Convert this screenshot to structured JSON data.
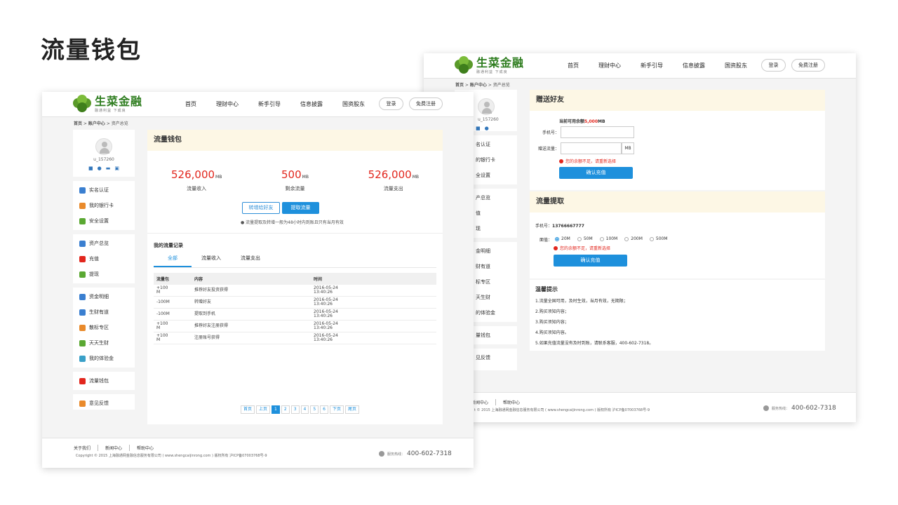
{
  "page_title": "流量钱包",
  "site": {
    "logo_name": "生菜金融",
    "logo_slogan": "融通利益 下成良",
    "nav": [
      "首页",
      "理财中心",
      "新手引导",
      "信息披露",
      "国资股东"
    ],
    "login": "登录",
    "register": "免费注册",
    "crumb_home": "首页",
    "crumb_account": "账户中心",
    "crumb_current": "资产总览"
  },
  "user": {
    "name": "u_157260"
  },
  "sidebar": {
    "groups": [
      [
        {
          "label": "实名认证",
          "color": "#3a7fd0"
        },
        {
          "label": "我的银行卡",
          "color": "#e98a2b"
        },
        {
          "label": "安全设置",
          "color": "#5aa832"
        }
      ],
      [
        {
          "label": "资产总览",
          "color": "#3a7fd0"
        },
        {
          "label": "充值",
          "color": "#e2261d"
        },
        {
          "label": "提现",
          "color": "#5aa832"
        }
      ],
      [
        {
          "label": "资金明细",
          "color": "#3a7fd0"
        },
        {
          "label": "生财有道",
          "color": "#3a7fd0"
        },
        {
          "label": "散标专区",
          "color": "#e98a2b"
        },
        {
          "label": "天天生财",
          "color": "#5aa832"
        },
        {
          "label": "我的体验金",
          "color": "#3aa0c8"
        }
      ],
      [
        {
          "label": "流量钱包",
          "color": "#e2261d"
        }
      ],
      [
        {
          "label": "意见反馈",
          "color": "#e98a2b"
        }
      ]
    ]
  },
  "back_sidebar": {
    "groups": [
      [
        "名认证",
        "的银行卡",
        "全设置"
      ],
      [
        "产总览",
        "值",
        "现"
      ],
      [
        "金明细",
        "财有道",
        "标专区",
        "天生财",
        "的体验金"
      ],
      [
        "量钱包"
      ],
      [
        "见反馈"
      ]
    ]
  },
  "wallet": {
    "title": "流量钱包",
    "stats": [
      {
        "value": "526,000",
        "unit": "MB",
        "label": "流量收入"
      },
      {
        "value": "500",
        "unit": "MB",
        "label": "剩余流量"
      },
      {
        "value": "526,000",
        "unit": "MB",
        "label": "流量支出"
      }
    ],
    "gift_btn": "转增给好友",
    "withdraw_btn": "提取流量",
    "note": "流量提取及转增一般为48小时内到账且只有当月有效",
    "records_title": "我的流量记录",
    "tabs": [
      "全部",
      "流量收入",
      "流量支出"
    ],
    "columns": [
      "流量包",
      "内容",
      "时间"
    ],
    "rows": [
      {
        "pkg": "+100\nM",
        "content": "推荐好友投资获得",
        "time": "2016-05-24\n13:40:26"
      },
      {
        "pkg": "-100M",
        "content": "转赠好友",
        "time": "2016-05-24\n13:40:26"
      },
      {
        "pkg": "-100M",
        "content": "提取到手机",
        "time": "2016-05-24\n13:40:26"
      },
      {
        "pkg": "+100\nM",
        "content": "推荐好友注册获得",
        "time": "2016-05-24\n13:40:26"
      },
      {
        "pkg": "+100\nM",
        "content": "注册账号获得",
        "time": "2016-05-24\n13:40:26"
      }
    ],
    "pager": {
      "first": "首页",
      "prev": "上页",
      "pages": [
        "1",
        "2",
        "3",
        "4",
        "5",
        "6"
      ],
      "next": "下页",
      "last": "尾页"
    }
  },
  "gift": {
    "title": "赠送好友",
    "balance_label": "当前可用余额",
    "balance_value": "5,000",
    "balance_unit": "MB",
    "phone_label": "手机号：",
    "amount_label": "赠送流量：",
    "amount_unit": "MB",
    "error": "您的余额不足，请重新选择",
    "confirm": "确认充值"
  },
  "withdraw": {
    "title": "流量提取",
    "phone_label": "手机号：",
    "phone_value": "13766667777",
    "face_label": "面值：",
    "options": [
      "20M",
      "50M",
      "100M",
      "200M",
      "500M"
    ],
    "error": "您的余额不足，请重新选择",
    "confirm": "确认充值"
  },
  "tips": {
    "title": "温馨提示",
    "lines": [
      "1.流量全国可用，及时生效，当月有效，无期限；",
      "2.购买须知内容；",
      "3.购买须知内容；",
      "4.购买须知内容。",
      "5.如果充值流量没有及时到账，请联系客服，400-602-7318。"
    ]
  },
  "footer": {
    "links": [
      "关于我们",
      "新闻中心",
      "帮助中心"
    ],
    "back_links": [
      "",
      "新闻中心",
      "帮助中心"
    ],
    "copyright": "Copyright © 2015 上海融通网金融信息服务有限公司 ( www.shengcaijinrong.com ) 版权所有 沪ICP备07003768号-9",
    "back_copyright": "t © 2015 上海融通网金融信息服务有限公司 ( www.shengcaijinrong.com ) 版权所有 沪ICP备07003768号-9",
    "hotline_label": "服务热线：",
    "hotline": "400-602-7318"
  }
}
